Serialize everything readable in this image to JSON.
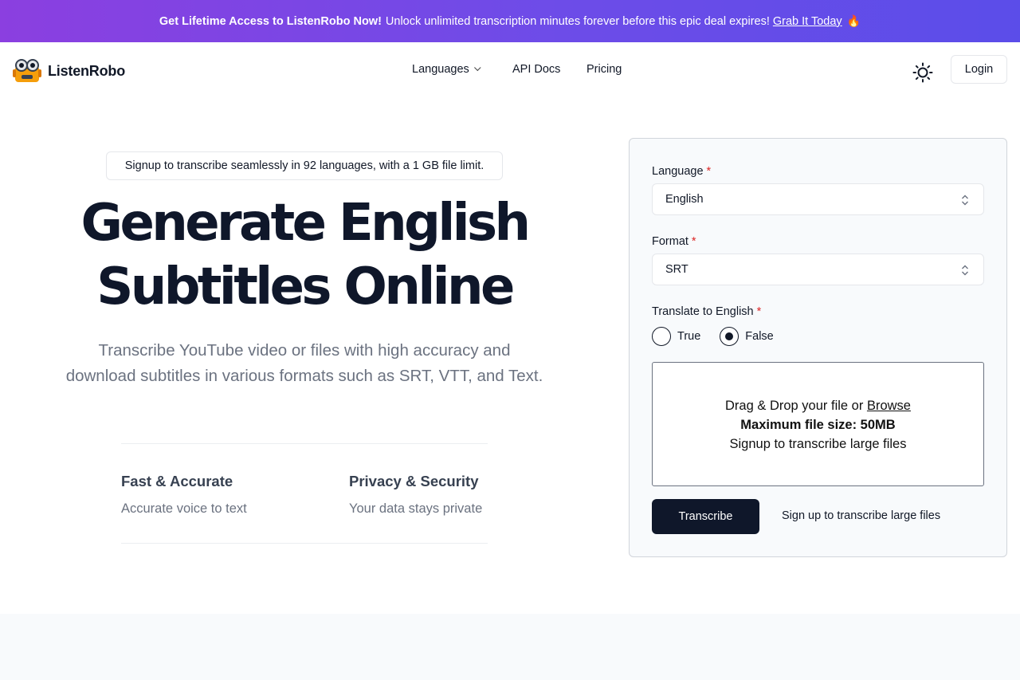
{
  "promo": {
    "headline": "Get Lifetime Access to ListenRobo Now!",
    "text": "Unlock unlimited transcription minutes forever before this epic deal expires!",
    "link": "Grab It Today",
    "emoji": "🔥"
  },
  "header": {
    "brand": "ListenRobo",
    "nav": {
      "languages": "Languages",
      "api_docs": "API Docs",
      "pricing": "Pricing"
    },
    "login": "Login",
    "theme_icon": "sun-icon"
  },
  "hero": {
    "pill": "Signup to transcribe seamlessly in 92 languages, with a 1 GB file limit.",
    "title_line1": "Generate English",
    "title_line2": "Subtitles Online",
    "subtitle_line1": "Transcribe YouTube video or files with high accuracy and",
    "subtitle_line2": "download subtitles in various formats such as SRT, VTT, and Text.",
    "features": [
      {
        "title": "Fast & Accurate",
        "desc": "Accurate voice to text"
      },
      {
        "title": "Privacy & Security",
        "desc": "Your data stays private"
      }
    ]
  },
  "form": {
    "language_label": "Language",
    "language_value": "English",
    "format_label": "Format",
    "format_value": "SRT",
    "translate_label": "Translate to English",
    "required_mark": "*",
    "option_true": "True",
    "option_false": "False",
    "selected_option": "False",
    "dropzone": {
      "prefix": "Drag & Drop your file or",
      "browse": "Browse",
      "max_size": "Maximum file size: 50MB",
      "signup_hint": "Signup to transcribe large files"
    },
    "transcribe_button": "Transcribe",
    "signup_link": "Sign up to transcribe large files"
  },
  "colors": {
    "banner_start": "#8b3fe0",
    "banner_end": "#5b4de9",
    "primary": "#0f172a",
    "required": "#dc2626",
    "muted": "#6b7280"
  }
}
